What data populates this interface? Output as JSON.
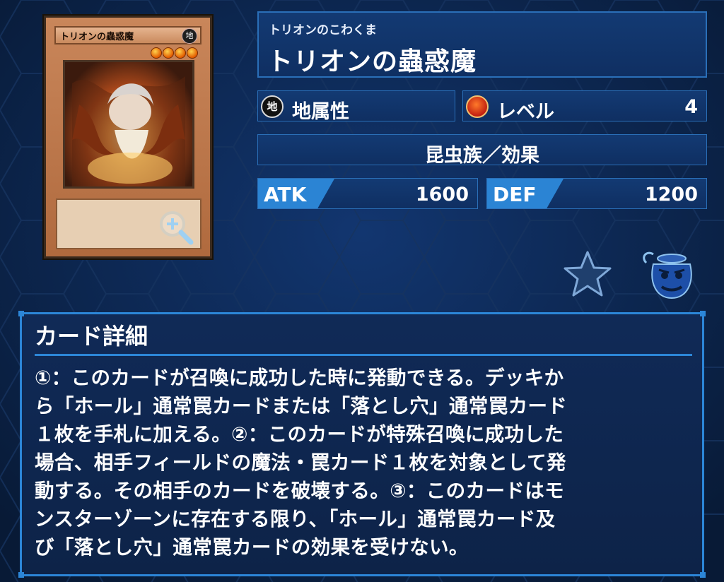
{
  "card": {
    "name": "トリオンの蟲惑魔",
    "ruby": "トリオンのこわくま",
    "card_attribute_glyph": "地",
    "level_stars": 4
  },
  "stats": {
    "attribute": {
      "icon": "earth-attribute-icon",
      "glyph": "地",
      "label": "地属性"
    },
    "level": {
      "icon": "level-star-icon",
      "label": "レベル",
      "value": "4"
    },
    "type": "昆虫族／効果",
    "atk": {
      "label": "ATK",
      "value": "1600"
    },
    "def": {
      "label": "DEF",
      "value": "1200"
    }
  },
  "actions": {
    "zoom_icon": "zoom-in-icon",
    "favorite_icon": "favorite-star-icon",
    "deck_icon": "pot-of-greed-icon"
  },
  "detail": {
    "title": "カード詳細",
    "text": "①：このカードが召喚に成功した時に発動できる。デッキか\nら「ホール」通常罠カードまたは「落とし穴」通常罠カード\n１枚を手札に加える。②：このカードが特殊召喚に成功した\n場合、相手フィールドの魔法・罠カード１枚を対象として発\n動する。その相手のカードを破壊する。③：このカードはモ\nンスターゾーンに存在する限り、「ホール」通常罠カード及\nび「落とし穴」通常罠カードの効果を受けない。"
  },
  "colors": {
    "background": "#0b1f3e",
    "panel": "#133a73",
    "accent": "#2c86d8",
    "stat_tag": "#2b84d4"
  }
}
